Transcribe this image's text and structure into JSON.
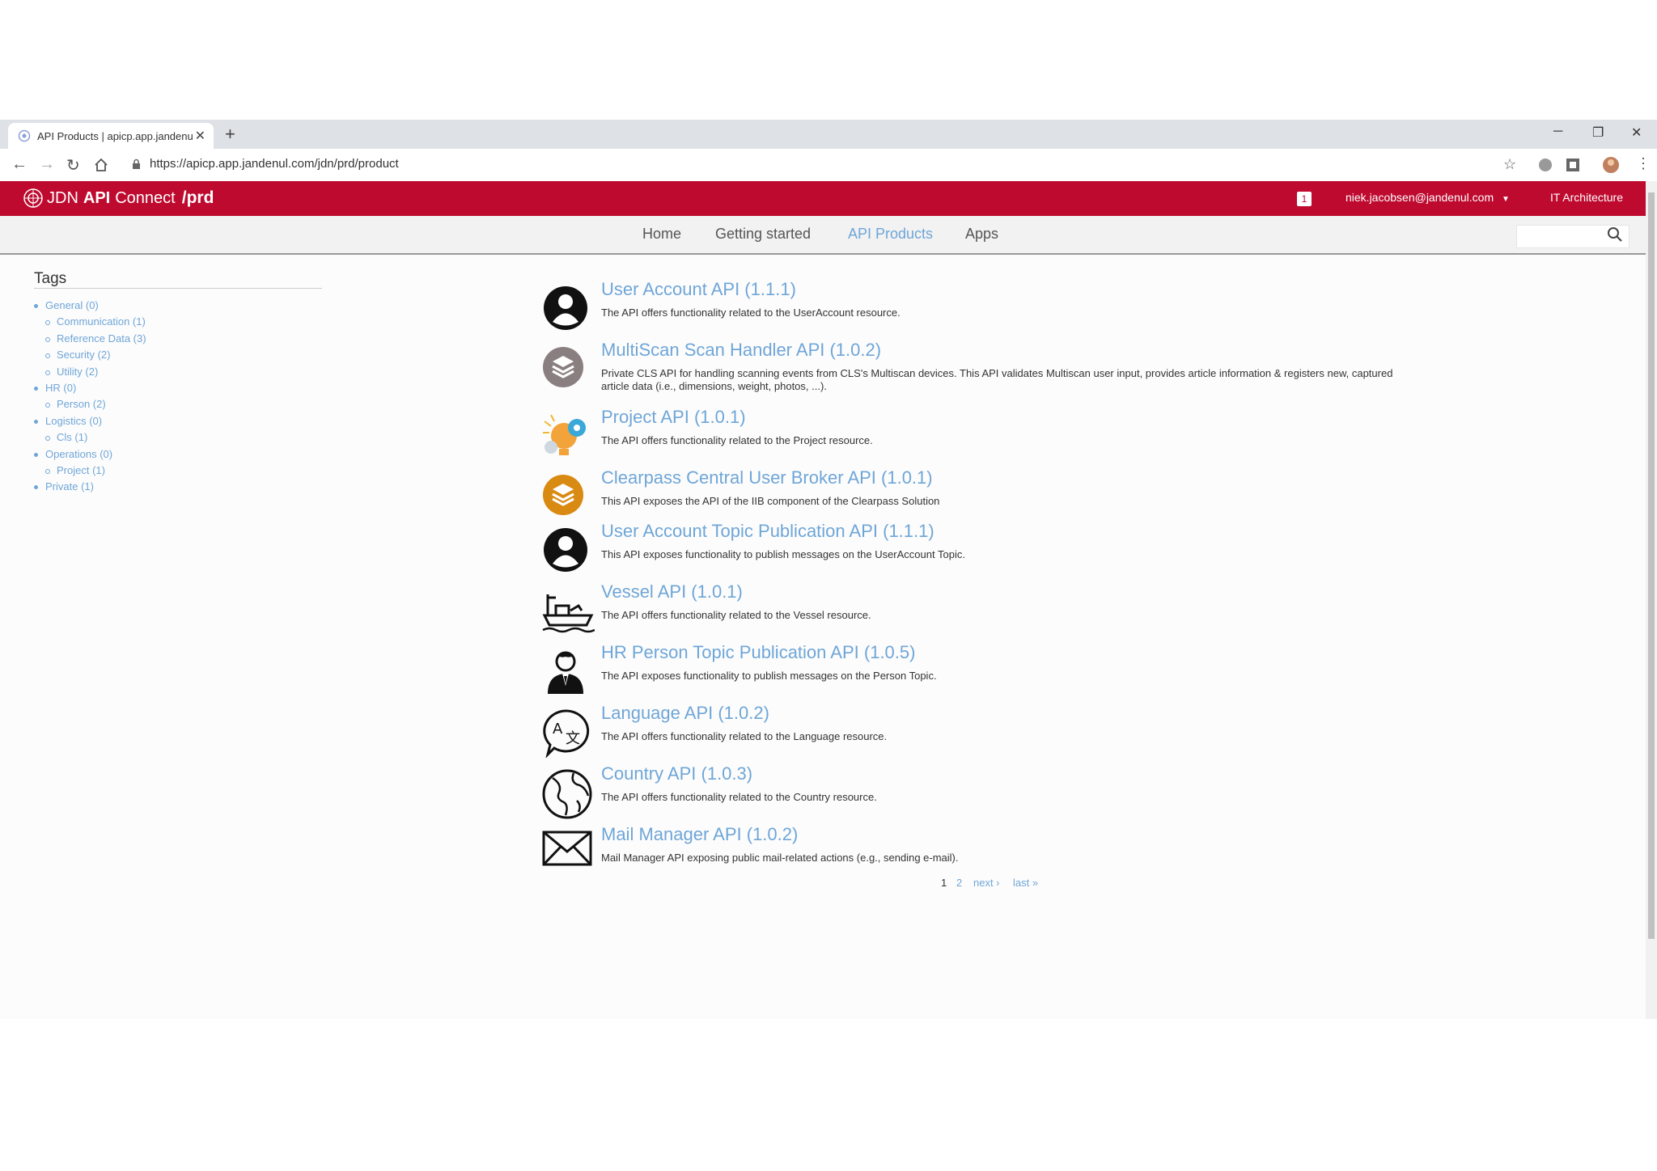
{
  "browser": {
    "tab_title": "API Products | apicp.app.jandenul...",
    "url": "https://apicp.app.jandenul.com/jdn/prd/product"
  },
  "appbar": {
    "brand_jdn": "JDN",
    "brand_api": "API",
    "brand_connect": "Connect",
    "brand_env": "/prd",
    "notification_count": "1",
    "user_email": "niek.jacobsen@jandenul.com",
    "org": "IT Architecture"
  },
  "nav": {
    "items": [
      "Home",
      "Getting started",
      "API Products",
      "Apps"
    ],
    "active": "API Products"
  },
  "sidebar": {
    "title": "Tags",
    "tags": [
      {
        "label": "General (0)",
        "level": 0
      },
      {
        "label": "Communication (1)",
        "level": 1
      },
      {
        "label": "Reference Data (3)",
        "level": 1
      },
      {
        "label": "Security (2)",
        "level": 1
      },
      {
        "label": "Utility (2)",
        "level": 1
      },
      {
        "label": "HR (0)",
        "level": 0
      },
      {
        "label": "Person (2)",
        "level": 1
      },
      {
        "label": "Logistics (0)",
        "level": 0
      },
      {
        "label": "Cls (1)",
        "level": 1
      },
      {
        "label": "Operations (0)",
        "level": 0
      },
      {
        "label": "Project (1)",
        "level": 1
      },
      {
        "label": "Private (1)",
        "level": 0
      }
    ]
  },
  "products": [
    {
      "title": "User Account API (1.1.1)",
      "icon": "user-circle-icon",
      "desc": "The API offers functionality related to the UserAccount resource."
    },
    {
      "title": "MultiScan Scan Handler API (1.0.2)",
      "icon": "layers-grey-icon",
      "desc": "Private CLS API for handling scanning events from CLS's Multiscan devices. This API validates Multiscan user input, provides article information & registers new, captured article data (i.e., dimensions, weight, photos, ...)."
    },
    {
      "title": "Project API (1.0.1)",
      "icon": "lightbulb-gear-icon",
      "desc": "The API offers functionality related to the Project resource."
    },
    {
      "title": "Clearpass Central User Broker API (1.0.1)",
      "icon": "layers-orange-icon",
      "desc": "This API exposes the API of the IIB component of the Clearpass Solution"
    },
    {
      "title": "User Account Topic Publication API (1.1.1)",
      "icon": "user-circle-icon",
      "desc": "This API exposes functionality to publish messages on the UserAccount Topic."
    },
    {
      "title": "Vessel API (1.0.1)",
      "icon": "ship-icon",
      "desc": "The API offers functionality related to the Vessel resource."
    },
    {
      "title": "HR Person Topic Publication API (1.0.5)",
      "icon": "person-tie-icon",
      "desc": "The API exposes functionality to publish messages on the Person Topic."
    },
    {
      "title": "Language API (1.0.2)",
      "icon": "translate-bubble-icon",
      "desc": "The API offers functionality related to the Language resource."
    },
    {
      "title": "Country API (1.0.3)",
      "icon": "globe-icon",
      "desc": "The API offers functionality related to the Country resource."
    },
    {
      "title": "Mail Manager API (1.0.2)",
      "icon": "envelope-icon",
      "desc": "Mail Manager API exposing public mail-related actions (e.g., sending e-mail)."
    }
  ],
  "pager": {
    "current": "1",
    "page2": "2",
    "next": "next ›",
    "last": "last »"
  }
}
